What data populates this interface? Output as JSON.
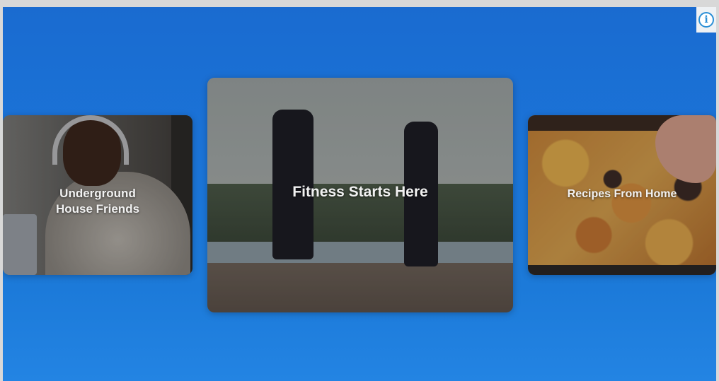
{
  "info_button": {
    "icon": "info-icon",
    "glyph": "i",
    "color": "#2b8fd6"
  },
  "cards": [
    {
      "id": "left",
      "title": "Underground\nHouse Friends"
    },
    {
      "id": "center",
      "title": "Fitness Starts Here"
    },
    {
      "id": "right",
      "title": "Recipes From Home"
    }
  ],
  "colors": {
    "background_top": "#1a6bd0",
    "background_bottom": "#2384e3",
    "frame": "#d8d8d8",
    "title_text": "#f1f1f1"
  }
}
